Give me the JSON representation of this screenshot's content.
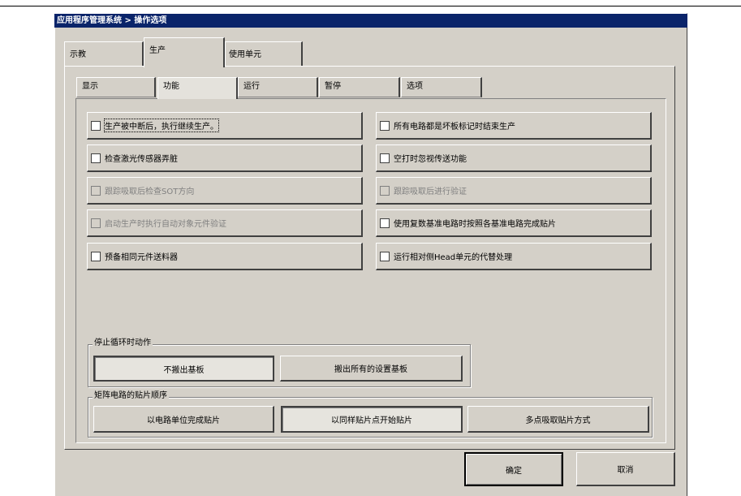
{
  "window": {
    "title": "应用程序管理系统 > 操作选项"
  },
  "main_tabs": [
    {
      "label": "示教",
      "active": false
    },
    {
      "label": "生产",
      "active": true
    },
    {
      "label": "使用单元",
      "active": false
    }
  ],
  "sub_tabs": [
    {
      "label": "显示",
      "active": false
    },
    {
      "label": "功能",
      "active": true
    },
    {
      "label": "运行",
      "active": false
    },
    {
      "label": "暂停",
      "active": false
    },
    {
      "label": "选项",
      "active": false
    }
  ],
  "options": [
    {
      "label": "生产被中断后，执行继续生产。",
      "checked": false,
      "enabled": true
    },
    {
      "label": "所有电路都是坏板标记时结束生产",
      "checked": false,
      "enabled": true
    },
    {
      "label": "检查激光传感器弄脏",
      "checked": false,
      "enabled": true
    },
    {
      "label": "空打时忽视传送功能",
      "checked": false,
      "enabled": true
    },
    {
      "label": "跟踪吸取后检查SOT方向",
      "checked": false,
      "enabled": false
    },
    {
      "label": "跟踪吸取后进行验证",
      "checked": false,
      "enabled": false
    },
    {
      "label": "启动生产时执行自动对象元件验证",
      "checked": false,
      "enabled": false
    },
    {
      "label": "使用复数基准电路时按照各基准电路完成贴片",
      "checked": false,
      "enabled": true
    },
    {
      "label": "预备相同元件送料器",
      "checked": false,
      "enabled": true
    },
    {
      "label": "运行相对侧Head单元的代替处理",
      "checked": false,
      "enabled": true
    }
  ],
  "stop_group": {
    "label": "停止循环时动作",
    "buttons": [
      {
        "label": "不搬出基板",
        "selected": true
      },
      {
        "label": "搬出所有的设置基板",
        "selected": false
      }
    ]
  },
  "order_group": {
    "label": "矩阵电路的贴片顺序",
    "buttons": [
      {
        "label": "以电路单位完成贴片",
        "selected": false
      },
      {
        "label": "以同样贴片点开始贴片",
        "selected": true
      },
      {
        "label": "多点吸取贴片方式",
        "selected": false
      }
    ]
  },
  "footer": {
    "ok_label": "确定",
    "cancel_label": "取消"
  }
}
